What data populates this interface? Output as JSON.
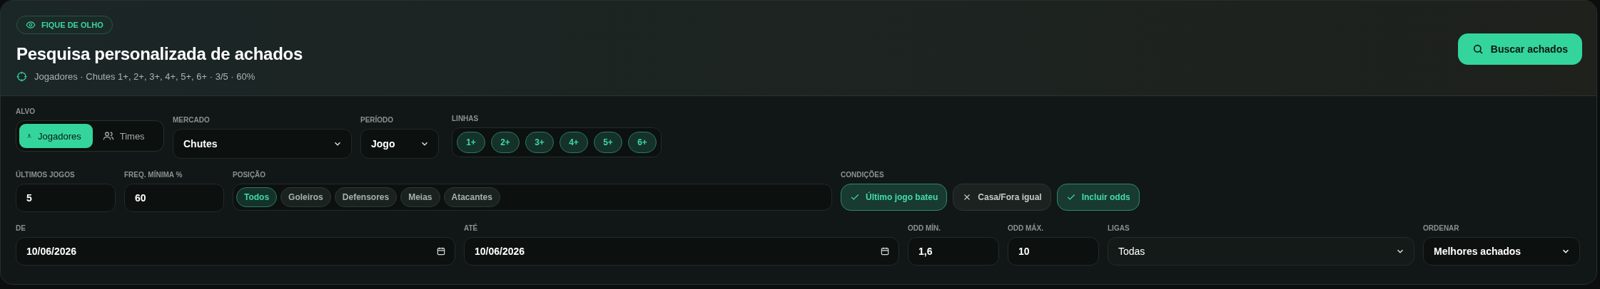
{
  "header": {
    "badge": "FIQUE DE OLHO",
    "title": "Pesquisa personalizada de achados",
    "summary": "Jogadores · Chutes 1+, 2+, 3+, 4+, 5+, 6+ · 3/5 · 60%",
    "search_button": "Buscar achados"
  },
  "alvo": {
    "label": "ALVO",
    "options": [
      {
        "label": "Jogadores",
        "selected": true
      },
      {
        "label": "Times",
        "selected": false
      }
    ]
  },
  "mercado": {
    "label": "MERCADO",
    "value": "Chutes"
  },
  "periodo": {
    "label": "PERÍODO",
    "value": "Jogo"
  },
  "linhas": {
    "label": "LINHAS",
    "chips": [
      {
        "label": "1+",
        "selected": true
      },
      {
        "label": "2+",
        "selected": true
      },
      {
        "label": "3+",
        "selected": true
      },
      {
        "label": "4+",
        "selected": true
      },
      {
        "label": "5+",
        "selected": true
      },
      {
        "label": "6+",
        "selected": true
      }
    ]
  },
  "ultimos_jogos": {
    "label": "ÚLTIMOS JOGOS",
    "value": "5"
  },
  "freq_minima": {
    "label": "FREQ. MÍNIMA %",
    "value": "60"
  },
  "posicao": {
    "label": "POSIÇÃO",
    "chips": [
      {
        "label": "Todos",
        "selected": true
      },
      {
        "label": "Goleiros",
        "selected": false
      },
      {
        "label": "Defensores",
        "selected": false
      },
      {
        "label": "Meias",
        "selected": false
      },
      {
        "label": "Atacantes",
        "selected": false
      }
    ]
  },
  "condicoes": {
    "label": "CONDIÇÕES",
    "chips": [
      {
        "label": "Último jogo bateu",
        "checked": true
      },
      {
        "label": "Casa/Fora igual",
        "checked": false
      },
      {
        "label": "Incluir odds",
        "checked": true
      }
    ]
  },
  "de": {
    "label": "DE",
    "value": "10/06/2026"
  },
  "ate": {
    "label": "ATÉ",
    "value": "10/06/2026"
  },
  "odd_min": {
    "label": "ODD MÍN.",
    "value": "1,6"
  },
  "odd_max": {
    "label": "ODD MÁX.",
    "value": "10"
  },
  "ligas": {
    "label": "LIGAS",
    "value": "Todas"
  },
  "ordenar": {
    "label": "ORDENAR",
    "value": "Melhores achados"
  }
}
